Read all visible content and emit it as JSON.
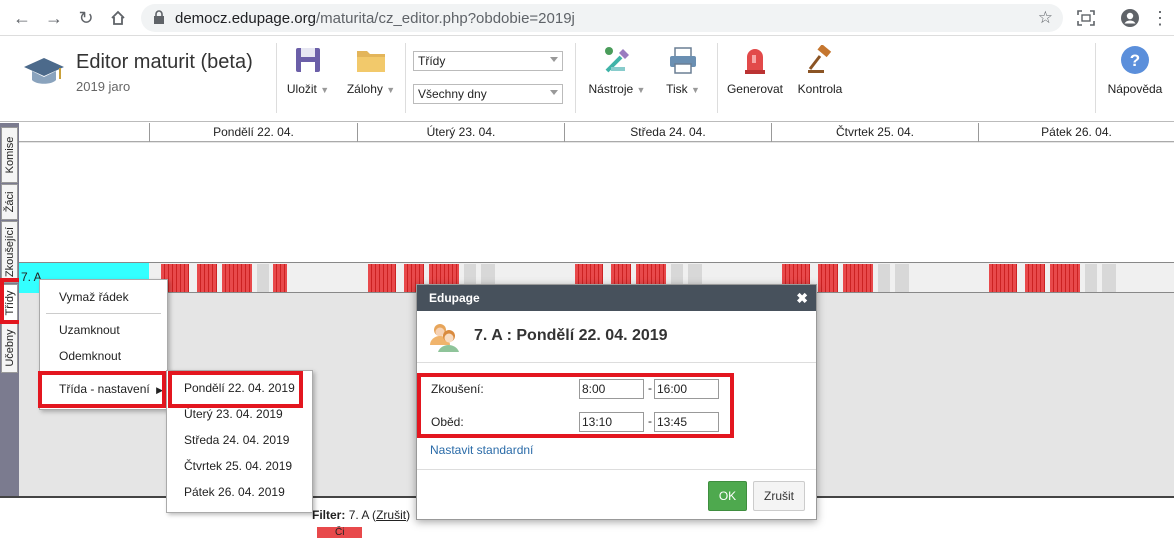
{
  "browser": {
    "url_host": "democz.edupage.org",
    "url_path": "/maturita/cz_editor.php?obdobie=2019j"
  },
  "app": {
    "title": "Editor maturit (beta)",
    "subtitle": "2019 jaro"
  },
  "toolbar": {
    "save_label": "Uložit",
    "backups_label": "Zálohy",
    "filter_select": "Třídy",
    "days_select": "Všechny dny",
    "tools_label": "Nástroje",
    "print_label": "Tisk",
    "generate_label": "Generovat",
    "check_label": "Kontrola",
    "help_label": "Nápověda"
  },
  "vertical_tabs": [
    "Komise",
    "Žáci",
    "Zkoušející",
    "Třídy",
    "Učebny"
  ],
  "days": [
    "Pondělí 22. 04.",
    "Úterý 23. 04.",
    "Středa 24. 04.",
    "Čtvrtek 25. 04.",
    "Pátek 26. 04."
  ],
  "class_row": {
    "label": "7. A"
  },
  "context_menu": {
    "items": [
      "Vymaž řádek",
      "Uzamknout",
      "Odemknout",
      "Třída - nastavení"
    ],
    "submenu_arrow": "▶"
  },
  "submenu": {
    "items": [
      "Pondělí 22. 04. 2019",
      "Úterý 23. 04. 2019",
      "Středa 24. 04. 2019",
      "Čtvrtek 25. 04. 2019",
      "Pátek 26. 04. 2019"
    ]
  },
  "filter": {
    "label": "Filter:",
    "value": "7. A",
    "cancel": "Zrušit",
    "chip": "Či"
  },
  "dialog": {
    "header": "Edupage",
    "close": "✖",
    "title": "7. A : Pondělí 22. 04. 2019",
    "exam_label": "Zkoušení:",
    "exam_from": "8:00",
    "exam_to": "16:00",
    "lunch_label": "Oběd:",
    "lunch_from": "13:10",
    "lunch_to": "13:45",
    "dash": "-",
    "reset_link": "Nastavit standardní",
    "ok": "OK",
    "cancel": "Zrušit"
  },
  "colors": {
    "highlight": "#e3161f",
    "slot_red": "#e8494b",
    "class_label_bg": "#33ffff",
    "ok_green": "#4ea94e",
    "dialog_header": "#47515c"
  }
}
